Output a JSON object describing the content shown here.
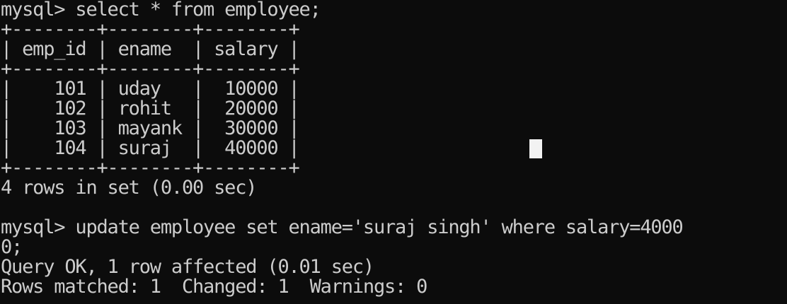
{
  "terminal": {
    "lines": [
      "mysql> select * from employee;",
      "+--------+--------+--------+",
      "| emp_id | ename  | salary |",
      "+--------+--------+--------+",
      "|    101 | uday   |  10000 |",
      "|    102 | rohit  |  20000 |",
      "|    103 | mayank |  30000 |",
      "|    104 | suraj  |  40000 |",
      "+--------+--------+--------+",
      "4 rows in set (0.00 sec)",
      "",
      "mysql> update employee set ename='suraj singh' where salary=4000",
      "0;",
      "Query OK, 1 row affected (0.01 sec)",
      "Rows matched: 1  Changed: 1  Warnings: 0"
    ]
  },
  "colors": {
    "background": "#0c0c0c",
    "text": "#cccccc",
    "cursor": "#f2f2f2"
  }
}
